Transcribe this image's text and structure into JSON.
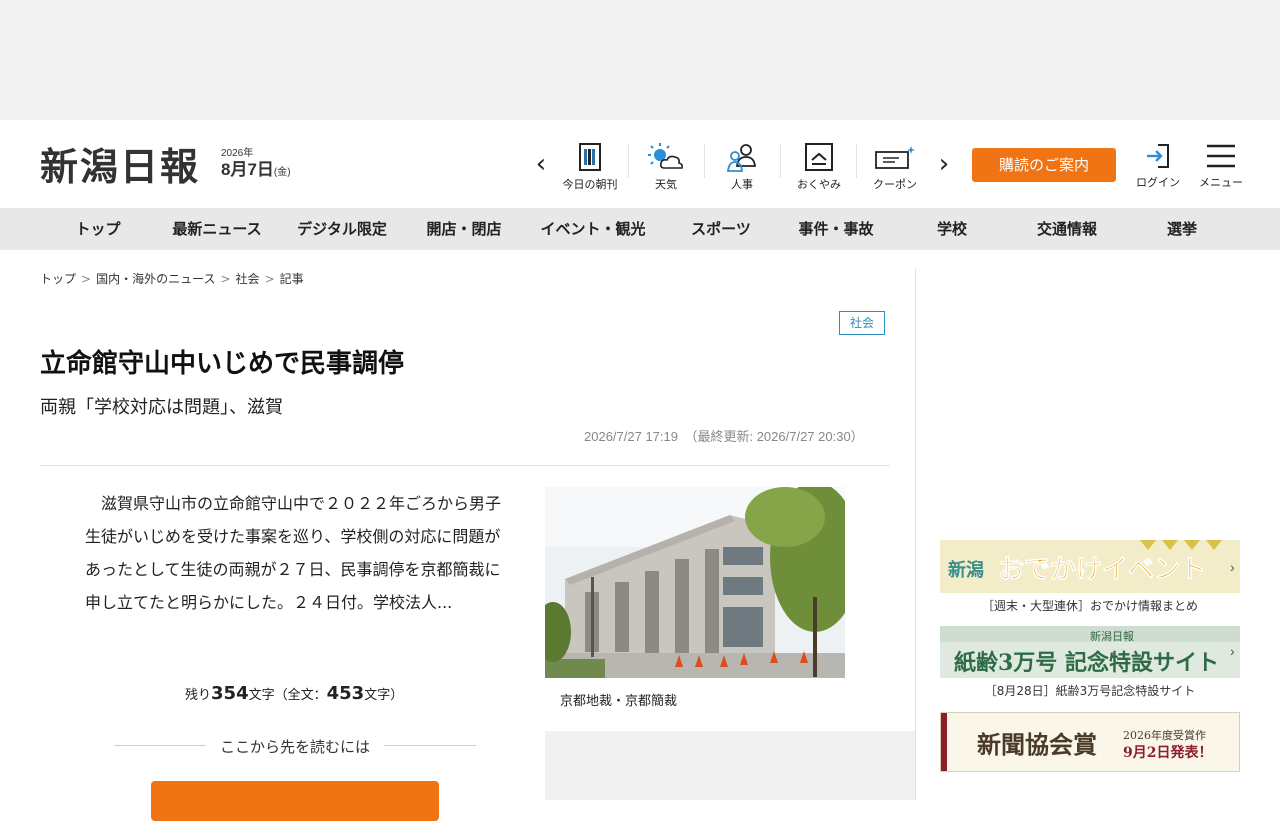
{
  "header": {
    "logo": "新潟日報",
    "date_year": "2026年",
    "date_month_day": "8月7日",
    "date_weekday": "(金)",
    "quick_nav": [
      {
        "label": "今日の朝刊",
        "icon": "newspaper-icon"
      },
      {
        "label": "天気",
        "icon": "weather-icon"
      },
      {
        "label": "人事",
        "icon": "people-icon"
      },
      {
        "label": "おくやみ",
        "icon": "condolence-icon"
      },
      {
        "label": "クーポン",
        "icon": "coupon-icon"
      }
    ],
    "subscribe_label": "購読のご案内",
    "login_label": "ログイン",
    "menu_label": "メニュー"
  },
  "global_nav": [
    "トップ",
    "最新ニュース",
    "デジタル限定",
    "開店・閉店",
    "イベント・観光",
    "スポーツ",
    "事件・事故",
    "学校",
    "交通情報",
    "選挙"
  ],
  "breadcrumb": [
    "トップ",
    "国内・海外のニュース",
    "社会",
    "記事"
  ],
  "article": {
    "category": "社会",
    "title": "立命館守山中いじめで民事調停",
    "subtitle": "両親「学校対応は問題」、滋賀",
    "timestamp": "2026/7/27 17:19　（最終更新: 2026/7/27 20:30）",
    "body": "　滋賀県守山市の立命館守山中で２０２２年ごろから男子生徒がいじめを受けた事案を巡り、学校側の対応に問題があったとして生徒の両親が２７日、民事調停を京都簡裁に申し立てたと明らかにした。２４日付。学校法人...",
    "remaining_prefix": "残り",
    "remaining_count": "354",
    "remaining_mid": "文字（全文：",
    "total_count": "453",
    "remaining_suffix": "文字）",
    "read_more_label": "ここから先を読むには",
    "photo_caption": "京都地裁・京都簡裁"
  },
  "sidebar": {
    "banners": [
      {
        "caption": "［週末・大型連休］おでかけ情報まとめ",
        "text_a": "新潟",
        "text_b": "おでかけイベント"
      },
      {
        "caption": "［8月28日］紙齢3万号記念特設サイト",
        "text_a": "新潟日報",
        "text_b": "紙齢3万号 記念特設サイト"
      },
      {
        "caption": "",
        "text_a": "新聞協会賞",
        "text_b": "2026年度受賞作 9月2日発表！"
      }
    ]
  },
  "colors": {
    "accent_orange": "#f07314",
    "nav_bg": "#e8e8e8",
    "tag_blue": "#2a8fbd"
  }
}
